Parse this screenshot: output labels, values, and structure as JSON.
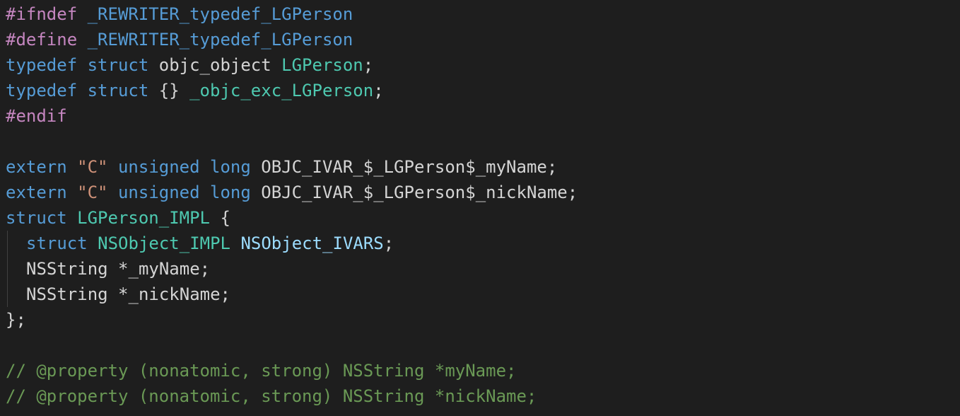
{
  "editor": {
    "theme": "dark",
    "background": "#1e1e1e",
    "colors": {
      "preprocessor": "#c586c0",
      "keyword": "#569cd6",
      "type": "#4ec9b0",
      "string": "#ce9178",
      "variable": "#9cdcfe",
      "text": "#d4d4d4",
      "comment": "#6a9955"
    },
    "lines": [
      [
        {
          "t": "#ifndef",
          "c": "pre"
        },
        {
          "t": " ",
          "c": "plain"
        },
        {
          "t": "_REWRITER_typedef_LGPerson",
          "c": "macro"
        }
      ],
      [
        {
          "t": "#define",
          "c": "pre"
        },
        {
          "t": " ",
          "c": "plain"
        },
        {
          "t": "_REWRITER_typedef_LGPerson",
          "c": "macro"
        }
      ],
      [
        {
          "t": "typedef",
          "c": "kw"
        },
        {
          "t": " ",
          "c": "plain"
        },
        {
          "t": "struct",
          "c": "kw"
        },
        {
          "t": " objc_object ",
          "c": "plain"
        },
        {
          "t": "LGPerson",
          "c": "type"
        },
        {
          "t": ";",
          "c": "plain"
        }
      ],
      [
        {
          "t": "typedef",
          "c": "kw"
        },
        {
          "t": " ",
          "c": "plain"
        },
        {
          "t": "struct",
          "c": "kw"
        },
        {
          "t": " {} ",
          "c": "plain"
        },
        {
          "t": "_objc_exc_LGPerson",
          "c": "type"
        },
        {
          "t": ";",
          "c": "plain"
        }
      ],
      [
        {
          "t": "#endif",
          "c": "pre"
        }
      ],
      [],
      [
        {
          "t": "extern",
          "c": "kw"
        },
        {
          "t": " ",
          "c": "plain"
        },
        {
          "t": "\"C\"",
          "c": "str"
        },
        {
          "t": " ",
          "c": "plain"
        },
        {
          "t": "unsigned",
          "c": "kw"
        },
        {
          "t": " ",
          "c": "plain"
        },
        {
          "t": "long",
          "c": "kw"
        },
        {
          "t": " OBJC_IVAR_$_LGPerson$_myName;",
          "c": "plain"
        }
      ],
      [
        {
          "t": "extern",
          "c": "kw"
        },
        {
          "t": " ",
          "c": "plain"
        },
        {
          "t": "\"C\"",
          "c": "str"
        },
        {
          "t": " ",
          "c": "plain"
        },
        {
          "t": "unsigned",
          "c": "kw"
        },
        {
          "t": " ",
          "c": "plain"
        },
        {
          "t": "long",
          "c": "kw"
        },
        {
          "t": " OBJC_IVAR_$_LGPerson$_nickName;",
          "c": "plain"
        }
      ],
      [
        {
          "t": "struct",
          "c": "kw"
        },
        {
          "t": " ",
          "c": "plain"
        },
        {
          "t": "LGPerson_IMPL",
          "c": "type"
        },
        {
          "t": " {",
          "c": "plain"
        }
      ],
      {
        "indent": true,
        "tokens": [
          {
            "t": "struct",
            "c": "kw"
          },
          {
            "t": " ",
            "c": "plain"
          },
          {
            "t": "NSObject_IMPL",
            "c": "type"
          },
          {
            "t": " ",
            "c": "plain"
          },
          {
            "t": "NSObject_IVARS",
            "c": "var"
          },
          {
            "t": ";",
            "c": "plain"
          }
        ]
      },
      {
        "indent": true,
        "tokens": [
          {
            "t": "NSString *_myName;",
            "c": "plain"
          }
        ]
      },
      {
        "indent": true,
        "tokens": [
          {
            "t": "NSString *_nickName;",
            "c": "plain"
          }
        ]
      },
      [
        {
          "t": "};",
          "c": "plain"
        }
      ],
      [],
      [
        {
          "t": "// @property (nonatomic, strong) NSString *myName;",
          "c": "cmt"
        }
      ],
      [
        {
          "t": "// @property (nonatomic, strong) NSString *nickName;",
          "c": "cmt"
        }
      ]
    ]
  }
}
